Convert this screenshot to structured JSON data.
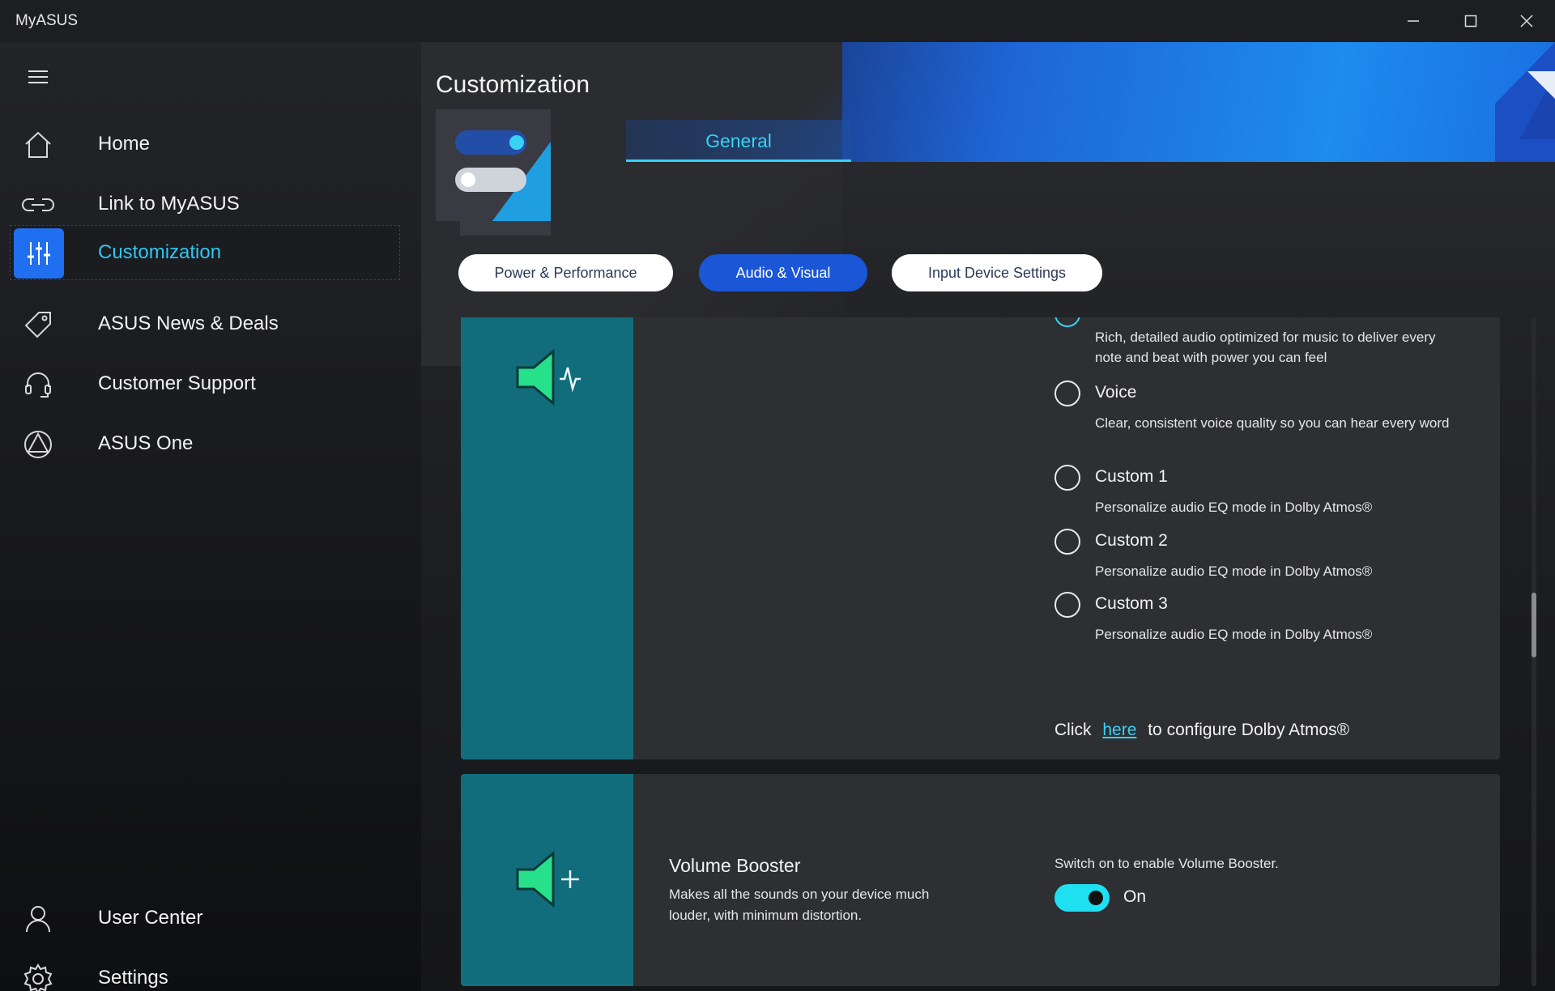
{
  "window": {
    "title": "MyASUS"
  },
  "sidebar": {
    "items": [
      {
        "label": "Home",
        "icon": "home-icon"
      },
      {
        "label": "Link to MyASUS",
        "icon": "link-icon"
      },
      {
        "label": "Customization",
        "icon": "sliders-icon",
        "active": true
      },
      {
        "label": "ASUS News & Deals",
        "icon": "tag-icon"
      },
      {
        "label": "Customer Support",
        "icon": "headset-icon"
      },
      {
        "label": "ASUS One",
        "icon": "asus-one-icon"
      }
    ],
    "bottom_items": [
      {
        "label": "User Center",
        "icon": "user-icon"
      },
      {
        "label": "Settings",
        "icon": "gear-icon"
      }
    ]
  },
  "main": {
    "title": "Customization",
    "tab": "General",
    "subtabs": [
      "Power & Performance",
      "Audio & Visual",
      "Input Device Settings"
    ],
    "active_subtab": "Audio & Visual",
    "audio_card": {
      "partial_desc": "Rich, detailed audio optimized for music to deliver every note and beat with power you can feel",
      "options": [
        {
          "title": "Voice",
          "desc": "Clear, consistent voice quality so you can hear every word"
        },
        {
          "title": "Custom 1",
          "desc": "Personalize audio EQ mode in Dolby Atmos®"
        },
        {
          "title": "Custom 2",
          "desc": "Personalize audio EQ mode in Dolby Atmos®"
        },
        {
          "title": "Custom 3",
          "desc": "Personalize audio EQ mode in Dolby Atmos®"
        }
      ],
      "dolby_prefix": "Click",
      "dolby_link": "here",
      "dolby_suffix": "to configure Dolby Atmos®"
    },
    "booster_card": {
      "title": "Volume Booster",
      "desc": "Makes all the sounds on your device much louder, with minimum distortion.",
      "hint": "Switch on to enable Volume Booster.",
      "toggle_label": "On",
      "toggle_on": true
    }
  },
  "colors": {
    "accent": "#39d0f5",
    "active_pill": "#1a56d6",
    "card_side": "#116d7c",
    "toggle_on": "#1fe0f0"
  }
}
